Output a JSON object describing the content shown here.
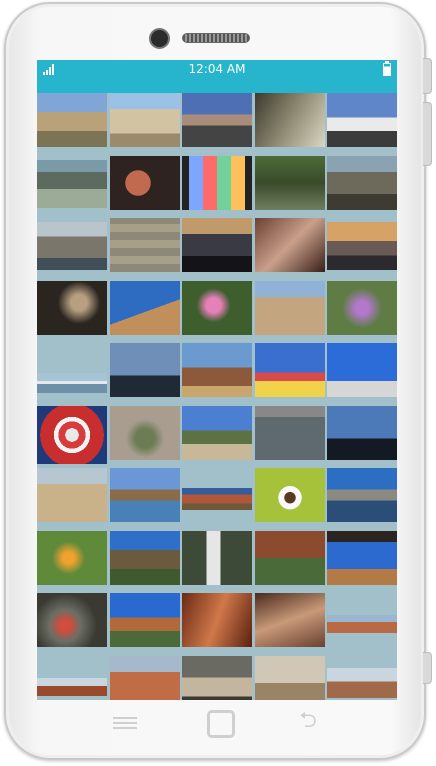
{
  "status_bar": {
    "time": "12:04 AM"
  },
  "colors": {
    "accent": "#26b5cd",
    "grid_background": "#a2c0ca"
  },
  "icons": {
    "signal": "signal-icon",
    "battery": "battery-icon",
    "menu": "menu-icon",
    "home": "home-icon",
    "back": "back-icon"
  },
  "thumbnails": [
    [
      "desert-scrub",
      "rock-formation",
      "mountain-road",
      "canyon-river",
      "white-house"
    ],
    [
      "lake-valley",
      "car-seat",
      "colored-lights",
      "ruined-building",
      "rocky-hillside"
    ],
    [
      "coastal-cliffs",
      "stone-wall",
      "ocean-sunset",
      "ceiling-interior",
      "sunset-shore"
    ],
    [
      "dark-interior",
      "dome-sky",
      "pink-flowers",
      "city-buildings",
      "purple-flowers"
    ],
    [
      "harbor",
      "skyline-clouds",
      "metal-sculpture",
      "festival-tents",
      "ferris-wheel"
    ],
    [
      "target-sign",
      "agave-rocks",
      "desert-trees",
      "building-facade",
      "night-sky"
    ],
    [
      "cow-field",
      "river-bridge",
      "red-rocks-panorama",
      "coffee-cup",
      "canal"
    ],
    [
      "yellow-flowers",
      "canyon-trees",
      "waterfall",
      "canyon-stream",
      "rock-arch"
    ],
    [
      "stones-flowers",
      "mesa-landscape",
      "red-rock-slot",
      "cave-wall",
      "red-mesa-panorama"
    ],
    [
      "panorama-red",
      "red-canyon",
      "cliff-dwelling",
      "cliff-ruins",
      "desert-panorama"
    ]
  ]
}
